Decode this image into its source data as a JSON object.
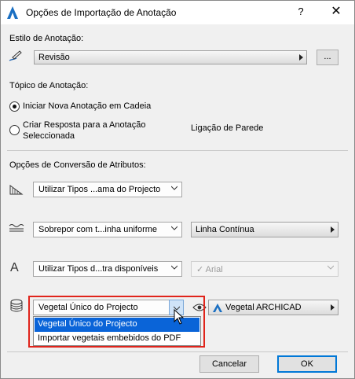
{
  "window": {
    "title": "Opções de Importação de Anotação",
    "help": "?",
    "close": "✕"
  },
  "style_section": {
    "label": "Estilo de Anotação:",
    "value": "Revisão",
    "more_button": "..."
  },
  "topic_section": {
    "label": "Tópico de Anotação:",
    "options": [
      {
        "label": "Iniciar Nova Anotação em Cadeia",
        "selected": true
      },
      {
        "label_line1": "Criar Resposta para a Anotação",
        "label_line2": "Seleccionada",
        "selected": false
      }
    ],
    "linked_label": "Ligação de Parede"
  },
  "conversion_section": {
    "label": "Opções de Conversão de Atributos:",
    "rows": [
      {
        "icon": "fill-icon",
        "dropdown": "Utilizar Tipos ...ama do Projecto"
      },
      {
        "icon": "line-type-icon",
        "dropdown": "Sobrepor com t...inha uniforme",
        "side_value": "Linha Contínua"
      },
      {
        "icon": "font-icon",
        "dropdown": "Utilizar Tipos d...tra disponíveis",
        "side_value": "Arial",
        "side_check": "✓"
      },
      {
        "icon": "surface-icon",
        "dropdown": "Vegetal Único do Projecto",
        "side_value": "Vegetal ARCHICAD"
      }
    ]
  },
  "dropdown_menu": {
    "items": [
      {
        "label": "Vegetal Único do Projecto",
        "highlighted": true
      },
      {
        "label": "Importar vegetais embebidos do PDF",
        "highlighted": false
      }
    ]
  },
  "footer": {
    "cancel": "Cancelar",
    "ok": "OK"
  },
  "colors": {
    "highlight": "#0a64d8",
    "callout": "#e0241b",
    "default_border": "#0078d7"
  }
}
